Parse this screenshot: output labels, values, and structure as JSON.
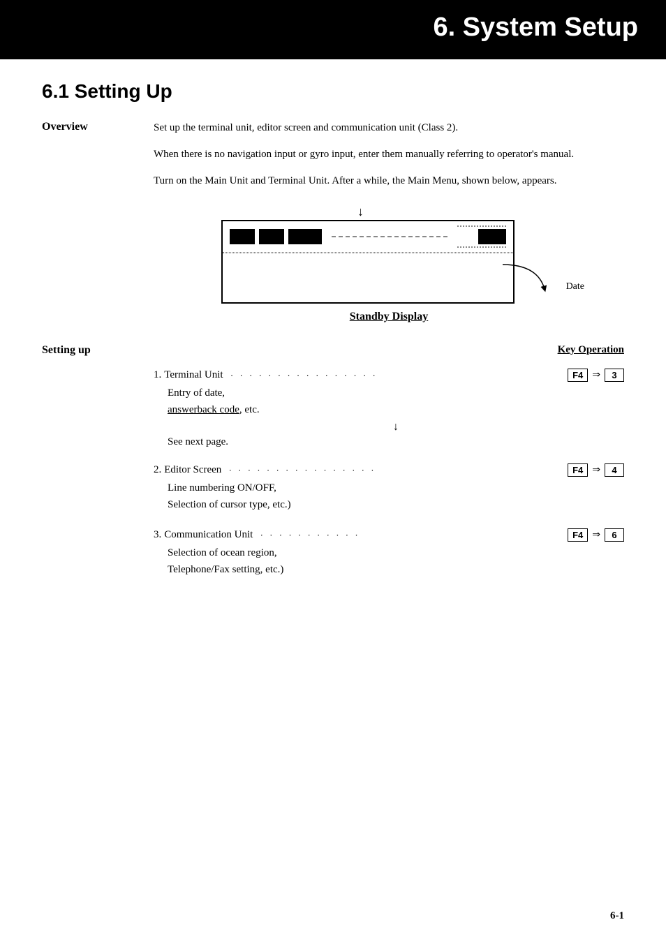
{
  "header": {
    "title": "6.  System Setup"
  },
  "section": {
    "number": "6.1",
    "title": "Setting Up"
  },
  "overview": {
    "label": "Overview",
    "paragraphs": [
      "Set up the terminal unit, editor screen and communication unit (Class 2).",
      "When there is no  navigation input or gyro input, enter them manually referring to operator's manual.",
      "Turn on the Main Unit and Terminal Unit. After a while, the Main Menu, shown below, appears."
    ]
  },
  "diagram": {
    "standby_label": "Standby Display",
    "date_label": "Date"
  },
  "setting_up": {
    "label": "Setting up",
    "key_operation_label": "Key Operation",
    "steps": [
      {
        "number": "1",
        "name": "Terminal Unit",
        "dots": "·················",
        "key": "F4",
        "value": "3",
        "sub_lines": [
          "Entry of date,",
          "answerback code, etc."
        ],
        "has_arrow": true,
        "arrow_text": "See next page."
      },
      {
        "number": "2",
        "name": "Editor Screen",
        "dots": "·················",
        "key": "F4",
        "value": "4",
        "sub_lines": [
          "Line numbering ON/OFF,",
          "Selection of cursor type, etc.)"
        ],
        "has_arrow": false
      },
      {
        "number": "3",
        "name": "Communication Unit",
        "dots": "···········",
        "key": "F4",
        "value": "6",
        "sub_lines": [
          "Selection of ocean region,",
          "Telephone/Fax setting, etc.)"
        ],
        "has_arrow": false
      }
    ]
  },
  "page_number": "6-1"
}
